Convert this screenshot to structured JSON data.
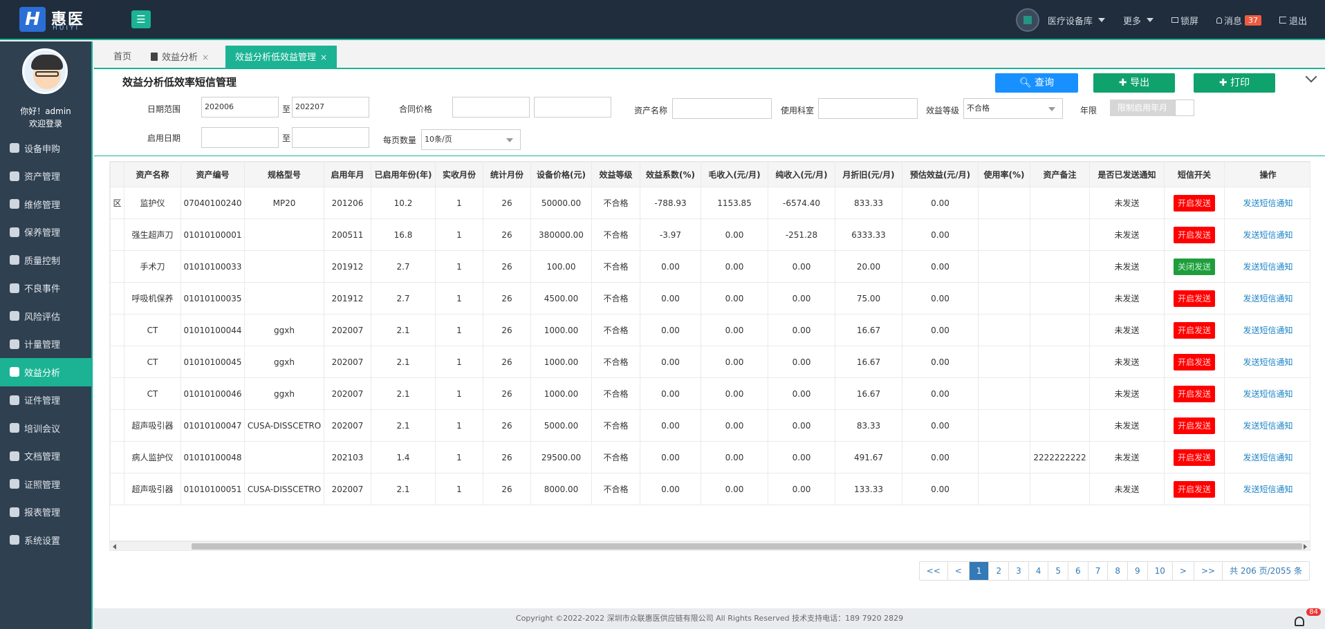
{
  "header": {
    "logo_cn": "惠医",
    "logo_en": "HUIYI",
    "logo_mark": "H",
    "menu_icon": "☰",
    "org": "医疗设备库",
    "more": "更多",
    "lock": "锁屏",
    "messages": "消息",
    "message_count": "37",
    "logout": "退出"
  },
  "sidebar": {
    "greeting": "你好！admin",
    "welcome": "欢迎登录",
    "items": [
      {
        "label": "设备申购",
        "icon": "cart-icon"
      },
      {
        "label": "资产管理",
        "icon": "asset-icon"
      },
      {
        "label": "维修管理",
        "icon": "wrench-icon"
      },
      {
        "label": "保养管理",
        "icon": "list-icon"
      },
      {
        "label": "质量控制",
        "icon": "shield-icon"
      },
      {
        "label": "不良事件",
        "icon": "scale-icon"
      },
      {
        "label": "风险评估",
        "icon": "shield-check-icon"
      },
      {
        "label": "计量管理",
        "icon": "calculator-icon"
      },
      {
        "label": "效益分析",
        "icon": "document-icon"
      },
      {
        "label": "证件管理",
        "icon": "cert-icon"
      },
      {
        "label": "培训会议",
        "icon": "list-icon"
      },
      {
        "label": "文档管理",
        "icon": "list-icon"
      },
      {
        "label": "证照管理",
        "icon": "license-icon"
      },
      {
        "label": "报表管理",
        "icon": "report-icon"
      },
      {
        "label": "系统设置",
        "icon": "gear-icon"
      }
    ]
  },
  "tabs": [
    {
      "label": "首页"
    },
    {
      "label": "效益分析"
    },
    {
      "label": "效益分析低效益管理"
    }
  ],
  "panel": {
    "title": "效益分析低效率短信管理",
    "query_label": "查询",
    "export_label": "导出",
    "print_label": "打印"
  },
  "filters": {
    "date_range_label": "日期范围",
    "date_from": "202006",
    "to_label": "至",
    "date_to": "202207",
    "contract_price_label": "合同价格",
    "asset_name_label": "资产名称",
    "department_label": "使用科室",
    "grade_label": "效益等级",
    "grade_value": "不合格",
    "years_label": "年限",
    "years_toggle": "限制启用年月",
    "start_date_label": "启用日期",
    "page_size_label": "每页数量",
    "page_size_value": "10条/页"
  },
  "table": {
    "columns": [
      "",
      "资产名称",
      "资产编号",
      "规格型号",
      "启用年月",
      "已启用年份(年)",
      "实收月份",
      "统计月份",
      "设备价格(元)",
      "效益等级",
      "效益系数(%)",
      "毛收入(元/月)",
      "纯收入(元/月)",
      "月折旧(元/月)",
      "预估效益(元/月)",
      "使用率(%)",
      "资产备注",
      "是否已发送通知",
      "短信开关",
      "操作"
    ],
    "rows": [
      {
        "lead": "区",
        "name": "监护仪",
        "code": "07040100240",
        "model": "MP20",
        "start": "201206",
        "years": "10.2",
        "paid": "1",
        "stat": "26",
        "price": "50000.00",
        "grade": "不合格",
        "coef": "-788.93",
        "gross": "1153.85",
        "net": "-6574.40",
        "dep": "833.33",
        "est": "0.00",
        "usage": "",
        "note": "",
        "sent": "未发送",
        "sms": "开启发送",
        "sms_on": true,
        "op": "发送短信通知"
      },
      {
        "lead": "",
        "name": "强生超声刀",
        "code": "01010100001",
        "model": "",
        "start": "200511",
        "years": "16.8",
        "paid": "1",
        "stat": "26",
        "price": "380000.00",
        "grade": "不合格",
        "coef": "-3.97",
        "gross": "0.00",
        "net": "-251.28",
        "dep": "6333.33",
        "est": "0.00",
        "usage": "",
        "note": "",
        "sent": "未发送",
        "sms": "开启发送",
        "sms_on": true,
        "op": "发送短信通知"
      },
      {
        "lead": "",
        "name": "手术刀",
        "code": "01010100033",
        "model": "",
        "start": "201912",
        "years": "2.7",
        "paid": "1",
        "stat": "26",
        "price": "100.00",
        "grade": "不合格",
        "coef": "0.00",
        "gross": "0.00",
        "net": "0.00",
        "dep": "20.00",
        "est": "0.00",
        "usage": "",
        "note": "",
        "sent": "未发送",
        "sms": "关闭发送",
        "sms_on": false,
        "op": "发送短信通知"
      },
      {
        "lead": "",
        "name": "呼吸机保养",
        "code": "01010100035",
        "model": "",
        "start": "201912",
        "years": "2.7",
        "paid": "1",
        "stat": "26",
        "price": "4500.00",
        "grade": "不合格",
        "coef": "0.00",
        "gross": "0.00",
        "net": "0.00",
        "dep": "75.00",
        "est": "0.00",
        "usage": "",
        "note": "",
        "sent": "未发送",
        "sms": "开启发送",
        "sms_on": true,
        "op": "发送短信通知"
      },
      {
        "lead": "",
        "name": "CT",
        "code": "01010100044",
        "model": "ggxh",
        "start": "202007",
        "years": "2.1",
        "paid": "1",
        "stat": "26",
        "price": "1000.00",
        "grade": "不合格",
        "coef": "0.00",
        "gross": "0.00",
        "net": "0.00",
        "dep": "16.67",
        "est": "0.00",
        "usage": "",
        "note": "",
        "sent": "未发送",
        "sms": "开启发送",
        "sms_on": true,
        "op": "发送短信通知"
      },
      {
        "lead": "",
        "name": "CT",
        "code": "01010100045",
        "model": "ggxh",
        "start": "202007",
        "years": "2.1",
        "paid": "1",
        "stat": "26",
        "price": "1000.00",
        "grade": "不合格",
        "coef": "0.00",
        "gross": "0.00",
        "net": "0.00",
        "dep": "16.67",
        "est": "0.00",
        "usage": "",
        "note": "",
        "sent": "未发送",
        "sms": "开启发送",
        "sms_on": true,
        "op": "发送短信通知"
      },
      {
        "lead": "",
        "name": "CT",
        "code": "01010100046",
        "model": "ggxh",
        "start": "202007",
        "years": "2.1",
        "paid": "1",
        "stat": "26",
        "price": "1000.00",
        "grade": "不合格",
        "coef": "0.00",
        "gross": "0.00",
        "net": "0.00",
        "dep": "16.67",
        "est": "0.00",
        "usage": "",
        "note": "",
        "sent": "未发送",
        "sms": "开启发送",
        "sms_on": true,
        "op": "发送短信通知"
      },
      {
        "lead": "",
        "name": "超声吸引器",
        "code": "01010100047",
        "model": "CUSA-DISSCETRO",
        "start": "202007",
        "years": "2.1",
        "paid": "1",
        "stat": "26",
        "price": "5000.00",
        "grade": "不合格",
        "coef": "0.00",
        "gross": "0.00",
        "net": "0.00",
        "dep": "83.33",
        "est": "0.00",
        "usage": "",
        "note": "",
        "sent": "未发送",
        "sms": "开启发送",
        "sms_on": true,
        "op": "发送短信通知"
      },
      {
        "lead": "",
        "name": "病人监护仪",
        "code": "01010100048",
        "model": "",
        "start": "202103",
        "years": "1.4",
        "paid": "1",
        "stat": "26",
        "price": "29500.00",
        "grade": "不合格",
        "coef": "0.00",
        "gross": "0.00",
        "net": "0.00",
        "dep": "491.67",
        "est": "0.00",
        "usage": "",
        "note": "2222222222",
        "sent": "未发送",
        "sms": "开启发送",
        "sms_on": true,
        "op": "发送短信通知"
      },
      {
        "lead": "",
        "name": "超声吸引器",
        "code": "01010100051",
        "model": "CUSA-DISSCETRO",
        "start": "202007",
        "years": "2.1",
        "paid": "1",
        "stat": "26",
        "price": "8000.00",
        "grade": "不合格",
        "coef": "0.00",
        "gross": "0.00",
        "net": "0.00",
        "dep": "133.33",
        "est": "0.00",
        "usage": "",
        "note": "",
        "sent": "未发送",
        "sms": "开启发送",
        "sms_on": true,
        "op": "发送短信通知"
      }
    ]
  },
  "pagination": {
    "first": "<<",
    "prev": "<",
    "pages": [
      "1",
      "2",
      "3",
      "4",
      "5",
      "6",
      "7",
      "8",
      "9",
      "10"
    ],
    "current": "1",
    "next": ">",
    "last": ">>",
    "total": "共 206 页/2055 条"
  },
  "footer": {
    "copyright": "Copyright ©2022-2022 深圳市众联惠医供应链有限公司 All Rights Reserved 技术支持电话：189 7920 2829",
    "notify_count": "84"
  },
  "colors": {
    "accent": "#1bb394",
    "header_bg": "#1f2d3d",
    "sidebar_bg": "#2f4050",
    "query_btn": "#1890ff",
    "export_btn": "#10a26c",
    "sms_on": "#ff0000",
    "sms_off": "#1f9d3c"
  }
}
